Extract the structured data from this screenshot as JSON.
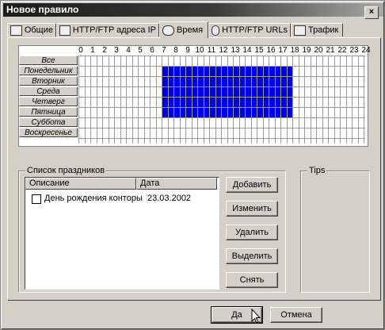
{
  "window": {
    "title": "Новое правило",
    "close_glyph": "×"
  },
  "tabs": [
    {
      "label": "Общие",
      "icon": "general-icon"
    },
    {
      "label": "HTTP/FTP адреса IP",
      "icon": "network-icon"
    },
    {
      "label": "Время",
      "icon": "clock-icon"
    },
    {
      "label": "HTTP/FTP URLs",
      "icon": "globe-icon"
    },
    {
      "label": "Трафик",
      "icon": "traffic-icon"
    }
  ],
  "schedule": {
    "hours": [
      "0",
      "1",
      "2",
      "3",
      "4",
      "5",
      "6",
      "7",
      "8",
      "9",
      "10",
      "11",
      "12",
      "13",
      "14",
      "15",
      "16",
      "17",
      "18",
      "19",
      "20",
      "21",
      "22",
      "23",
      "24"
    ],
    "days": [
      "Все",
      "Понедельник",
      "Вторник",
      "Среда",
      "Четверг",
      "Пятница",
      "Суббота",
      "Воскресенье"
    ],
    "selected": {
      "day_from": 1,
      "day_to": 5,
      "hour_from": 7,
      "hour_to": 18
    },
    "selected_color": "#0000e0"
  },
  "holidays": {
    "group_label": "Список праздников",
    "columns": [
      "Описание",
      "Дата"
    ],
    "rows": [
      {
        "description": "День рождения конторы",
        "date": "23.03.2002",
        "checked": false
      }
    ]
  },
  "tips": {
    "group_label": "Tips"
  },
  "side_buttons": [
    "Добавить",
    "Изменить",
    "Удалить",
    "Выделить",
    "Снять"
  ],
  "footer": {
    "ok": "Да",
    "cancel": "Отмена"
  }
}
